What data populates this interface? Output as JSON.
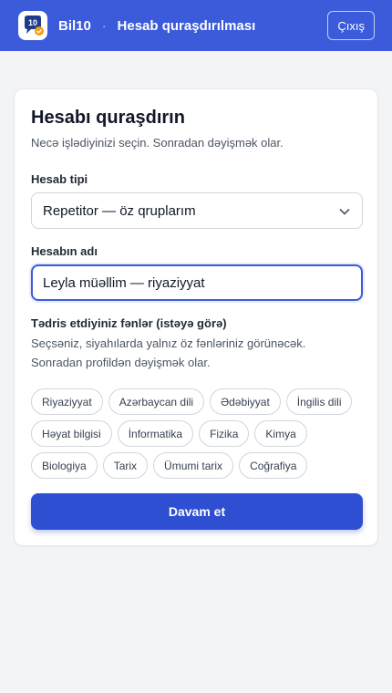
{
  "header": {
    "logo_text": "10",
    "brand": "Bil10",
    "separator": "·",
    "title": "Hesab quraşdırılması",
    "logout_label": "Çıxış"
  },
  "card": {
    "title": "Hesabı quraşdırın",
    "subtitle": "Necə işlədiyinizi seçin. Sonradan dəyişmək olar.",
    "account_type": {
      "label": "Hesab tipi",
      "selected": "Repetitor — öz qruplarım"
    },
    "account_name": {
      "label": "Hesabın adı",
      "value": "Leyla müəllim — riyaziyyat"
    },
    "subjects": {
      "label": "Tədris etdiyiniz fənlər (istəyə görə)",
      "help_line1": "Seçsəniz, siyahılarda yalnız öz fənləriniz görünəcək.",
      "help_line2": "Sonradan profildən dəyişmək olar.",
      "items": [
        "Riyaziyyat",
        "Azərbaycan dili",
        "Ədəbiyyat",
        "İngilis dili",
        "Həyat bilgisi",
        "İnformatika",
        "Fizika",
        "Kimya",
        "Biologiya",
        "Tarix",
        "Ümumi tarix",
        "Coğrafiya"
      ]
    },
    "continue_label": "Davam et"
  },
  "colors": {
    "header_bg": "#3b5bdb",
    "primary": "#2f4fd3",
    "page_bg": "#f3f4f6"
  },
  "icons": {
    "logo": "bil10-logo-icon",
    "select": "chevron-down-icon"
  }
}
